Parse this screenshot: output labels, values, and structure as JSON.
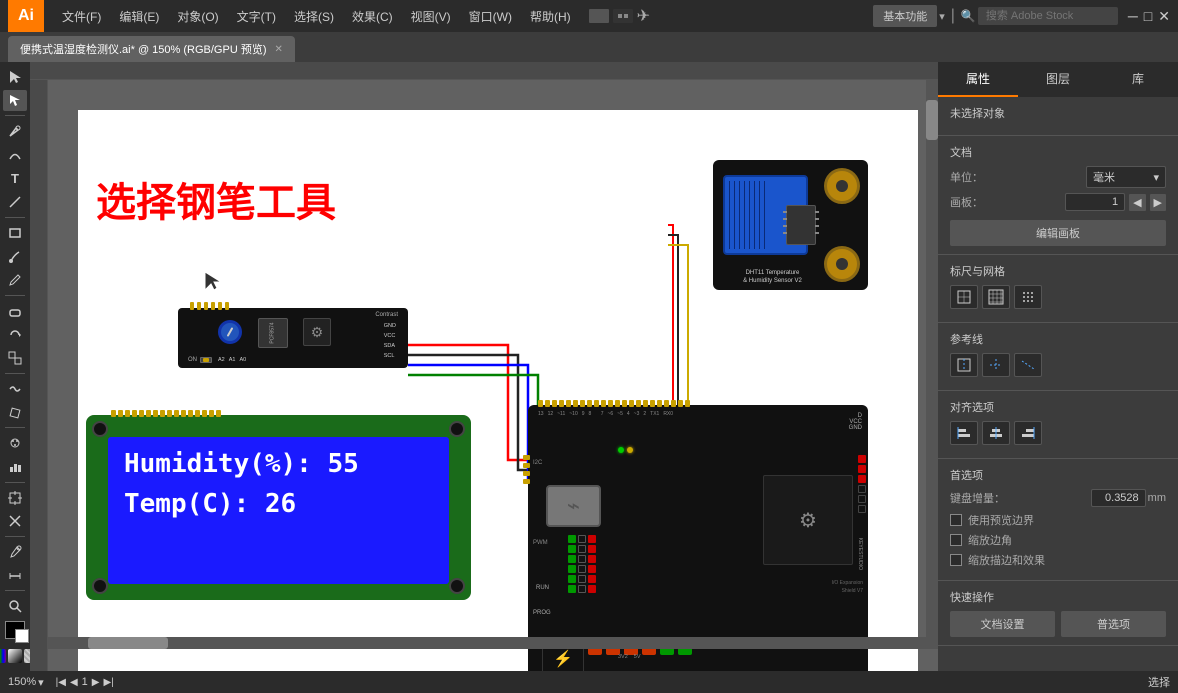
{
  "app": {
    "logo": "Ai",
    "title": "便携式温湿度检测仪.ai* @ 150% (RGB/GPU 预览)"
  },
  "menu": {
    "items": [
      "文件(F)",
      "编辑(E)",
      "对象(O)",
      "文字(T)",
      "选择(S)",
      "效果(C)",
      "视图(V)",
      "窗口(W)",
      "帮助(H)"
    ],
    "right_label": "基本功能",
    "search_placeholder": "搜索 Adobe Stock"
  },
  "canvas": {
    "pen_tool_text": "选择钢笔工具",
    "zoom": "150%",
    "page": "1",
    "mode": "选择",
    "humidity_label": "Humidity(%): 55",
    "temp_label": "Temp(C): 26"
  },
  "right_panel": {
    "tabs": [
      "属性",
      "图层",
      "库"
    ],
    "active_tab": "属性",
    "unselected_label": "未选择对象",
    "document_section": "文档",
    "unit_label": "单位：",
    "unit_value": "毫米",
    "canvas_label": "画板：",
    "canvas_value": "1",
    "canvas_btn": "编辑画板",
    "ruler_grid_section": "标尺与网格",
    "guides_section": "参考线",
    "align_section": "对齐选项",
    "prefs_section": "首选项",
    "keyboard_increment_label": "键盘增量：",
    "keyboard_increment_value": "0.3528",
    "keyboard_increment_unit": "mm",
    "use_preview_label": "使用预览边界",
    "scale_corners_label": "缩放边角",
    "scale_effects_label": "缩放描边和效果",
    "quick_actions_section": "快速操作",
    "doc_settings_btn": "文档设置",
    "prefs_btn": "普选项"
  },
  "status_bar": {
    "zoom": "150%",
    "page_prev": "◀",
    "page_num": "1",
    "page_next": "▶",
    "mode": "选择"
  }
}
